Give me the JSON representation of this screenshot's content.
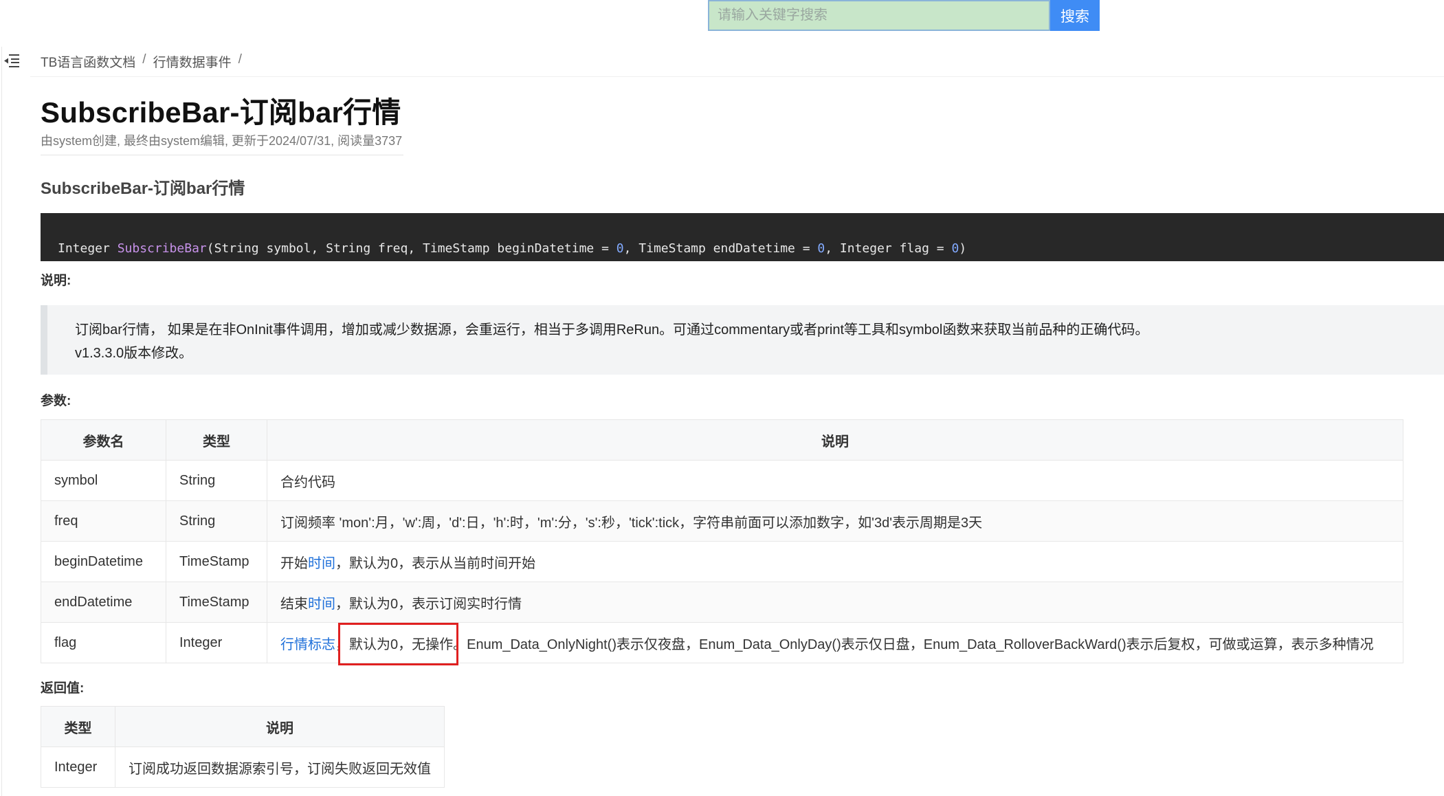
{
  "search": {
    "placeholder": "请输入关键字搜索",
    "button_label": "搜索"
  },
  "breadcrumb": {
    "items": [
      "TB语言函数文档",
      "行情数据事件"
    ],
    "separator": "/"
  },
  "page": {
    "title": "SubscribeBar-订阅bar行情",
    "meta": "由system创建, 最终由system编辑, 更新于2024/07/31, 阅读量3737",
    "section_title": "SubscribeBar-订阅bar行情"
  },
  "code": {
    "type": "Integer",
    "function": "SubscribeBar",
    "params_before_first_default": "(String symbol, String freq, TimeStamp beginDatetime = ",
    "default1": "0",
    "mid1": ", TimeStamp endDatetime = ",
    "default2": "0",
    "mid2": ", Integer flag = ",
    "default3": "0",
    "end": ")"
  },
  "description": {
    "label": "说明:",
    "lines": [
      "订阅bar行情， 如果是在非OnInit事件调用，增加或减少数据源，会重运行，相当于多调用ReRun。可通过commentary或者print等工具和symbol函数来获取当前品种的正确代码。",
      "v1.3.3.0版本修改。"
    ]
  },
  "params": {
    "label": "参数:",
    "headers": [
      "参数名",
      "类型",
      "说明"
    ],
    "rows": [
      {
        "name": "symbol",
        "type": "String",
        "desc": "合约代码"
      },
      {
        "name": "freq",
        "type": "String",
        "desc": "订阅频率 'mon':月，'w':周，'d':日，'h':时，'m':分，'s':秒，'tick':tick，字符串前面可以添加数字，如'3d'表示周期是3天"
      },
      {
        "name": "beginDatetime",
        "type": "TimeStamp",
        "desc_pre": "开始",
        "desc_link": "时间",
        "desc_post": "，默认为0，表示从当前时间开始"
      },
      {
        "name": "endDatetime",
        "type": "TimeStamp",
        "desc_pre": "结束",
        "desc_link": "时间",
        "desc_post": "，默认为0，表示订阅实时行情"
      },
      {
        "name": "flag",
        "type": "Integer",
        "desc_link": "行情标志",
        "desc_post": "，默认为0，无操作。Enum_Data_OnlyNight()表示仅夜盘，Enum_Data_OnlyDay()表示仅日盘，Enum_Data_RolloverBackWard()表示后复权，可做或运算，表示多种情况"
      }
    ]
  },
  "returns": {
    "label": "返回值:",
    "headers": [
      "类型",
      "说明"
    ],
    "rows": [
      {
        "type": "Integer",
        "desc": "订阅成功返回数据源索引号，订阅失败返回无效值"
      }
    ]
  }
}
